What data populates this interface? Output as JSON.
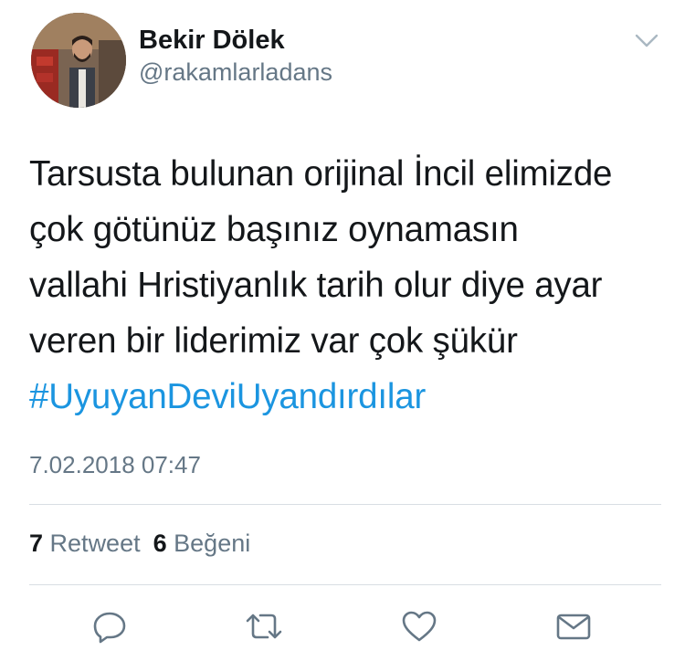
{
  "user": {
    "display_name": "Bekir Dölek",
    "handle": "@rakamlarladans",
    "avatar_icon": "profile-photo"
  },
  "tweet": {
    "lines": [
      "Tarsusta bulunan orijinal İncil elimizde",
      "çok götünüz başınız oynamasın",
      "vallahi Hristiyanlık tarih olur diye ayar",
      "veren bir liderimiz var çok şükür"
    ],
    "hashtag": "#UyuyanDeviUyandırdılar",
    "timestamp": "7.02.2018 07:47"
  },
  "stats": {
    "retweet_count": "7",
    "retweet_label": "Retweet",
    "like_count": "6",
    "like_label": "Beğeni"
  },
  "actions": {
    "icons": [
      "reply-icon",
      "retweet-icon",
      "like-icon",
      "direct-message-icon"
    ]
  },
  "colors": {
    "text": "#14171a",
    "secondary": "#657786",
    "link": "#1b95e0",
    "divider": "#d8dee3",
    "icon": "#657786"
  }
}
